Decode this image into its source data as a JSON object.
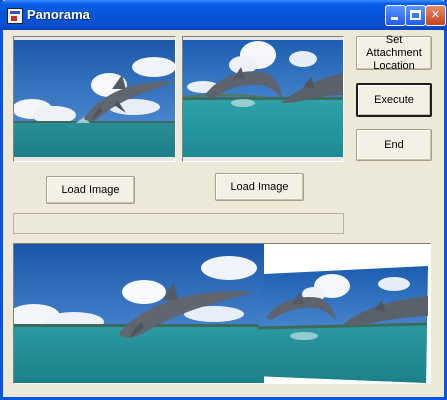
{
  "window": {
    "title": "Panorama"
  },
  "titlebar": {
    "minimize_icon": "minimize-icon",
    "maximize_icon": "maximize-icon",
    "close_icon": "close-icon",
    "close_glyph": "✕"
  },
  "buttons": {
    "set_attachment_line1": "Set Attachment",
    "set_attachment_line2": "Location",
    "execute": "Execute",
    "end": "End",
    "load_image_left": "Load Image",
    "load_image_right": "Load Image"
  },
  "progress": {
    "value": 0
  },
  "images": {
    "left": "dolphin-photo-left",
    "right": "dolphin-photo-right",
    "result": "panorama-result"
  },
  "colors": {
    "title_bar": "#0654d8",
    "sky": "#1a5fa0",
    "sea": "#1f9aa8",
    "window_bg": "#ece9d8"
  }
}
